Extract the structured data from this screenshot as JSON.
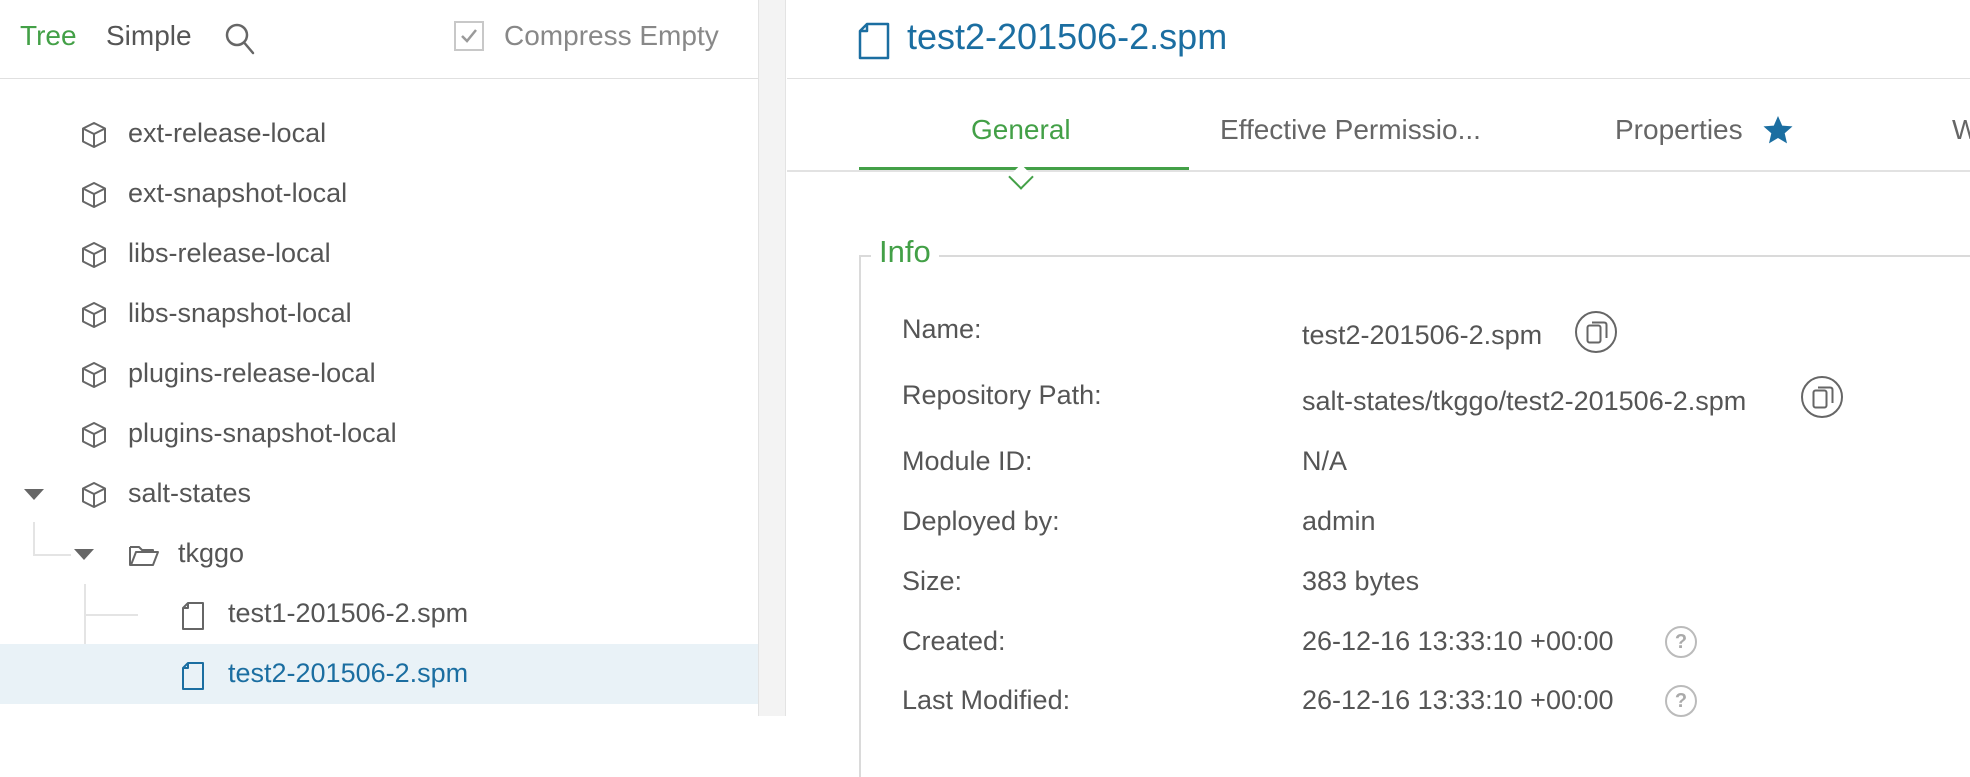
{
  "left_panel": {
    "tabs": {
      "tree": "Tree",
      "simple": "Simple"
    },
    "compress_empty": {
      "label": "Compress Empty",
      "checked": true
    },
    "tree": [
      {
        "label": "ext-release-local",
        "icon": "repository-icon"
      },
      {
        "label": "ext-snapshot-local",
        "icon": "repository-icon"
      },
      {
        "label": "libs-release-local",
        "icon": "repository-icon"
      },
      {
        "label": "libs-snapshot-local",
        "icon": "repository-icon"
      },
      {
        "label": "plugins-release-local",
        "icon": "repository-icon"
      },
      {
        "label": "plugins-snapshot-local",
        "icon": "repository-icon"
      },
      {
        "label": "salt-states",
        "icon": "repository-icon",
        "expanded": true
      },
      {
        "label": "tkggo",
        "icon": "folder-open-icon",
        "expanded": true
      },
      {
        "label": "test1-201506-2.spm",
        "icon": "file-icon"
      },
      {
        "label": "test2-201506-2.spm",
        "icon": "file-icon",
        "selected": true
      }
    ]
  },
  "right_panel": {
    "title": "test2-201506-2.spm",
    "tabs": [
      {
        "label": "General",
        "active": true
      },
      {
        "label": "Effective Permissio..."
      },
      {
        "label": "Properties",
        "starred": true
      },
      {
        "label": "W"
      }
    ],
    "info": {
      "legend": "Info",
      "rows": [
        {
          "label": "Name:",
          "value": "test2-201506-2.spm"
        },
        {
          "label": "Repository Path:",
          "value": "salt-states/tkggo/test2-201506-2.spm"
        },
        {
          "label": "Module ID:",
          "value": "N/A"
        },
        {
          "label": "Deployed by:",
          "value": "admin"
        },
        {
          "label": "Size:",
          "value": "383 bytes"
        },
        {
          "label": "Created:",
          "value": "26-12-16 13:33:10 +00:00"
        },
        {
          "label": "Last Modified:",
          "value": "26-12-16 13:33:10 +00:00"
        }
      ]
    }
  },
  "colors": {
    "accent_green": "#43a047",
    "link_blue": "#1b6ea1",
    "selected_row_bg": "#e9f2f7"
  }
}
